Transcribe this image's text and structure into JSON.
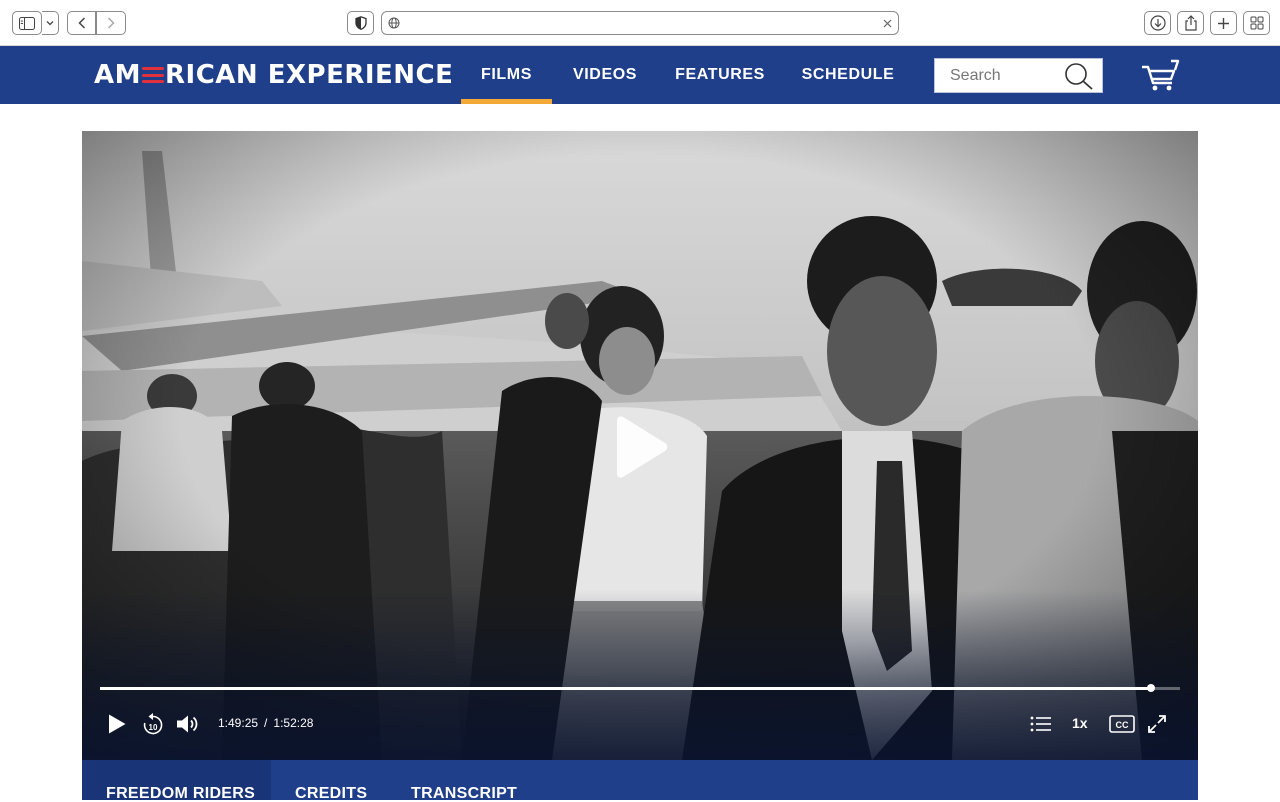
{
  "site": {
    "logo_part1": "AM",
    "logo_part2": "RICAN EXPERIENCE"
  },
  "nav": {
    "items": [
      {
        "label": "FILMS",
        "active": true
      },
      {
        "label": "VIDEOS",
        "active": false
      },
      {
        "label": "FEATURES",
        "active": false
      },
      {
        "label": "SCHEDULE",
        "active": false
      }
    ]
  },
  "search": {
    "placeholder": "Search"
  },
  "colors": {
    "header_blue": "#1f3f8a",
    "active_underline": "#f3a935",
    "logo_accent": "#e0323c"
  },
  "player": {
    "current_time": "1:49:25",
    "separator": "/",
    "duration": "1:52:28",
    "progress_fraction": 0.973,
    "speed": "1x",
    "icons": [
      "play-icon",
      "rewind-10-icon",
      "volume-icon",
      "chapters-icon",
      "closed-captions-icon",
      "fullscreen-icon"
    ]
  },
  "tabs": {
    "items": [
      {
        "label": "FREEDOM RIDERS",
        "active": true
      },
      {
        "label": "CREDITS",
        "active": false
      },
      {
        "label": "TRANSCRIPT",
        "active": false
      }
    ]
  }
}
